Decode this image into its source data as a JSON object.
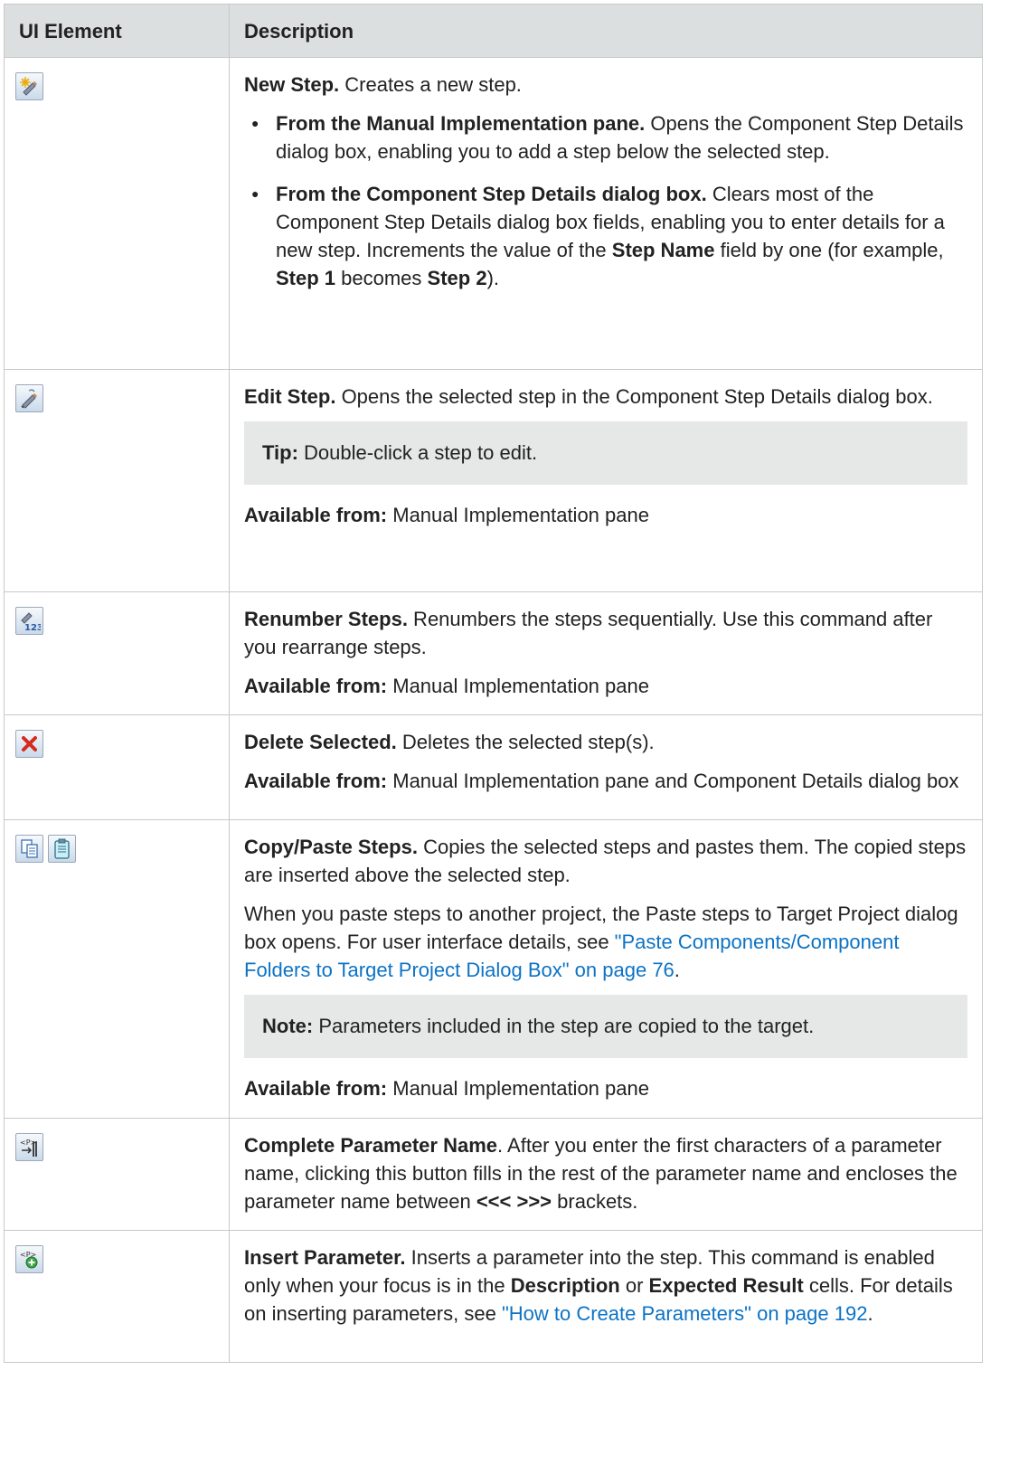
{
  "header": {
    "col1": "UI Element",
    "col2": "Description"
  },
  "rows": [
    {
      "icons": [
        "new-step-icon"
      ],
      "title": "New Step.",
      "text": " Creates a new step.",
      "bullets": [
        {
          "bold": "From the Manual Implementation pane.",
          "text": " Opens the Component Step Details dialog box, enabling you to add a step below the selected step."
        },
        {
          "bold": "From the Component Step Details dialog box.",
          "text1": " Clears most of the Component Step Details dialog box fields, enabling you to enter details for a new step. Increments the value of the ",
          "b1": "Step Name",
          "text2": " field by one (for example, ",
          "b2": "Step 1",
          "text3": " becomes ",
          "b3": "Step 2",
          "text4": ")."
        }
      ]
    },
    {
      "icons": [
        "edit-step-icon"
      ],
      "title": "Edit Step.",
      "text": " Opens the selected step in the Component Step Details dialog box.",
      "tip_label": "Tip:",
      "tip_text": " Double-click a step to edit.",
      "avail_label": "Available from:",
      "avail_text": " Manual Implementation pane"
    },
    {
      "icons": [
        "renumber-steps-icon"
      ],
      "title": "Renumber Steps.",
      "text": " Renumbers the steps sequentially. Use this command after you rearrange steps.",
      "avail_label": "Available from:",
      "avail_text": " Manual Implementation pane"
    },
    {
      "icons": [
        "delete-selected-icon"
      ],
      "title": "Delete Selected.",
      "text": " Deletes the selected step(s).",
      "avail_label": "Available from:",
      "avail_text": " Manual Implementation pane and Component Details dialog box"
    },
    {
      "icons": [
        "copy-icon",
        "paste-icon"
      ],
      "title": "Copy/Paste Steps.",
      "text": " Copies the selected steps and pastes them. The copied steps are inserted above the selected step.",
      "para2": "When you paste steps to another project, the Paste steps to Target Project dialog box opens. For user interface details, see ",
      "link": "\"Paste Components/Component Folders to Target Project Dialog Box\" on page 76",
      "para2_end": ".",
      "note_label": "Note:",
      "note_text": " Parameters included in the step are copied to the target.",
      "avail_label": "Available from:",
      "avail_text": " Manual Implementation pane"
    },
    {
      "icons": [
        "complete-parameter-name-icon"
      ],
      "title": "Complete Parameter Name",
      "text1": ". After you enter the first characters of a parameter name, clicking this button fills in the rest of the parameter name and encloses the parameter name between ",
      "brackets": "<<< >>>",
      "text2": " brackets."
    },
    {
      "icons": [
        "insert-parameter-icon"
      ],
      "title": "Insert Parameter.",
      "text1": " Inserts a parameter into the step. This command is enabled only when your focus is in the ",
      "b1": "Description",
      "text2": " or ",
      "b2": "Expected Result",
      "text3": " cells. For details on inserting parameters, see ",
      "link": "\"How to Create Parameters\" on page 192",
      "text4": "."
    }
  ],
  "colors": {
    "link": "#0c73c5",
    "header_bg": "#dcdfdf",
    "note_bg": "#e6e8e8",
    "border": "#c8c8c8"
  }
}
